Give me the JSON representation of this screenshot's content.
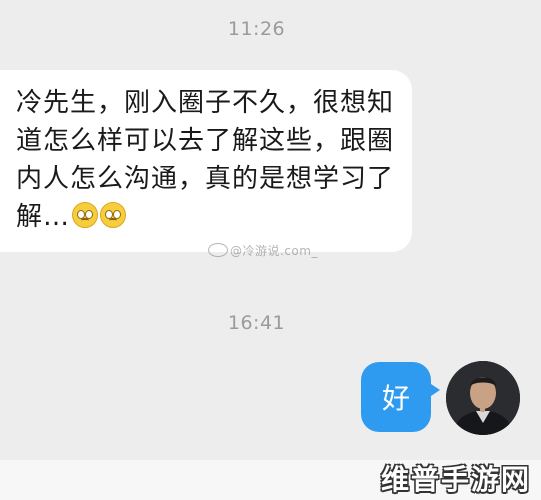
{
  "timestamps": [
    "11:26",
    "16:41"
  ],
  "incoming_message": {
    "text": "冷先生，刚入圈子不久，很想知道怎么样可以去了解这些，跟圈内人怎么沟通，真的是想学习了解…",
    "emojis": [
      "pleading-face",
      "pleading-face"
    ]
  },
  "watermark": "@冷游说.com_",
  "outgoing_message": {
    "text": "好"
  },
  "avatar_icon": "user-avatar",
  "brand": "维普手游网",
  "colors": {
    "background": "#ededed",
    "outgoing_bubble": "#2f9bf0",
    "incoming_bubble": "#ffffff"
  }
}
